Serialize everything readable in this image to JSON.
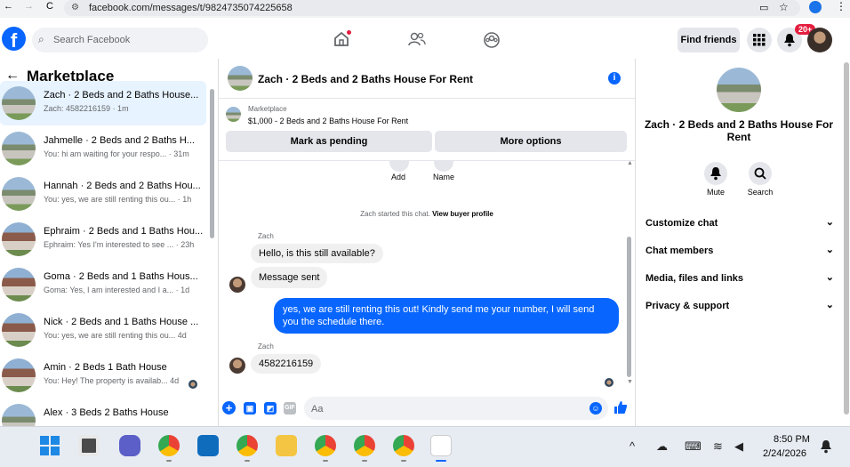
{
  "browser": {
    "url": "facebook.com/messages/t/9824735074225658",
    "nav_back": "←",
    "nav_forward": "→",
    "nav_reload": "C"
  },
  "header": {
    "logo": "f",
    "search_placeholder": "Search Facebook",
    "find_friends": "Find friends",
    "notif_count": "20+"
  },
  "marketplace": {
    "title": "Marketplace",
    "back": "←",
    "conversations": [
      {
        "title": "Zach · 2 Beds and 2 Baths House...",
        "sub": "Zach: 4582216159 · 1m"
      },
      {
        "title": "Jahmelle · 2 Beds and 2 Baths H...",
        "sub": "You: hi am waiting for your respo... · 31m"
      },
      {
        "title": "Hannah · 2 Beds and 2 Baths Hou...",
        "sub": "You: yes, we are still renting this ou... · 1h"
      },
      {
        "title": "Ephraim · 2 Beds and 1 Baths Hou...",
        "sub": "Ephraim: Yes I'm interested to see ... · 23h"
      },
      {
        "title": "Goma · 2 Beds and 1 Baths Hous...",
        "sub": "Goma: Yes, I am interested and I a... · 1d"
      },
      {
        "title": "Nick · 2 Beds and 1 Baths House ...",
        "sub": "You: yes, we are still renting this ou... 4d"
      },
      {
        "title": "Amin · 2 Beds 1 Bath House",
        "sub": "You: Hey! The property is availab... 4d"
      },
      {
        "title": "Alex · 3 Beds 2 Baths House",
        "sub": ""
      }
    ]
  },
  "chat": {
    "title": "Zach · 2 Beds and 2 Baths House For Rent",
    "listing_label": "Marketplace",
    "listing_price": "$1,000 - 2 Beds and 2 Baths House For Rent",
    "mark_pending": "Mark as pending",
    "more_options": "More options",
    "add_label": "Add",
    "name_label": "Name",
    "started_text": "Zach started this chat.",
    "view_profile": "View buyer profile",
    "sender1": "Zach",
    "msg1": "Hello, is this still available?",
    "msg2": "Message sent",
    "msg3": "yes, we are still renting this out! Kindly send me your number, I will send you the schedule there.",
    "sender2": "Zach",
    "msg4": "4582216159",
    "composer_placeholder": "Aa",
    "gif": "GIF"
  },
  "right_panel": {
    "title": "Zach · 2 Beds and 2 Baths House For Rent",
    "mute": "Mute",
    "search": "Search",
    "rows": [
      "Customize chat",
      "Chat members",
      "Media, files and links",
      "Privacy & support"
    ]
  },
  "taskbar": {
    "time": "8:50 PM",
    "date": "2/24/2026"
  },
  "colors": {
    "brand": "#0866ff",
    "badge": "#e41e3f"
  }
}
